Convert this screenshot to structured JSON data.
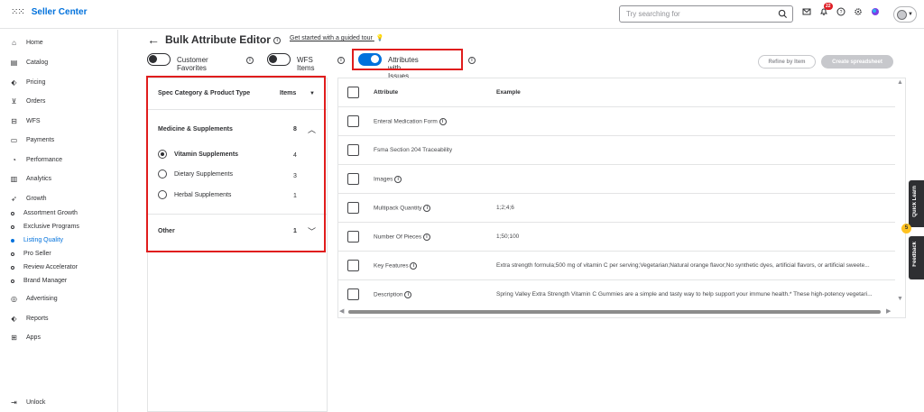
{
  "topbar": {
    "brand": "Seller Center",
    "search_placeholder": "Try searching for",
    "notification_count": "22"
  },
  "sidebar": {
    "items": [
      {
        "label": "Home",
        "icon": "home-icon"
      },
      {
        "label": "Catalog",
        "icon": "catalog-icon"
      },
      {
        "label": "Pricing",
        "icon": "tag-icon"
      },
      {
        "label": "Orders",
        "icon": "cart-icon"
      },
      {
        "label": "WFS",
        "icon": "warehouse-icon"
      },
      {
        "label": "Payments",
        "icon": "card-icon"
      },
      {
        "label": "Performance",
        "icon": "gauge-icon"
      },
      {
        "label": "Analytics",
        "icon": "bar-chart-icon"
      },
      {
        "label": "Growth",
        "icon": "rocket-icon"
      }
    ],
    "growth_sub": [
      {
        "label": "Assortment Growth",
        "active": false
      },
      {
        "label": "Exclusive Programs",
        "active": false
      },
      {
        "label": "Listing Quality",
        "active": true
      },
      {
        "label": "Pro Seller",
        "active": false
      },
      {
        "label": "Review Accelerator",
        "active": false
      },
      {
        "label": "Brand Manager",
        "active": false
      }
    ],
    "items2": [
      {
        "label": "Advertising",
        "icon": "target-icon"
      },
      {
        "label": "Reports",
        "icon": "report-icon"
      },
      {
        "label": "Apps",
        "icon": "apps-icon"
      }
    ],
    "unlock": "Unlock"
  },
  "header": {
    "title": "Bulk Attribute Editor",
    "guide_link": "Get started with a guided tour"
  },
  "toggles": [
    {
      "label": "Customer Favorites",
      "on": false
    },
    {
      "label": "WFS Items",
      "on": false
    },
    {
      "label": "Attributes with Issues",
      "on": true
    }
  ],
  "buttons": {
    "refine": "Refine by Item",
    "create": "Create spreadsheet"
  },
  "left_panel": {
    "header_label": "Spec Category & Product Type",
    "items_label": "Items",
    "group1": {
      "label": "Medicine & Supplements",
      "count": "8"
    },
    "options": [
      {
        "label": "Vitamin Supplements",
        "count": "4",
        "selected": true
      },
      {
        "label": "Dietary Supplements",
        "count": "3",
        "selected": false
      },
      {
        "label": "Herbal Supplements",
        "count": "1",
        "selected": false
      }
    ],
    "group2": {
      "label": "Other",
      "count": "1"
    }
  },
  "table": {
    "headers": {
      "attribute": "Attribute",
      "example": "Example"
    },
    "rows": [
      {
        "attribute": "Enteral Medication Form",
        "example": ""
      },
      {
        "attribute": "Fsma Section 204 Traceability",
        "example": ""
      },
      {
        "attribute": "Images",
        "example": ""
      },
      {
        "attribute": "Multipack Quantity",
        "example": "1;2;4;6"
      },
      {
        "attribute": "Number Of Pieces",
        "example": "1;50;100"
      },
      {
        "attribute": "Key Features",
        "example": "Extra strength formula;500 mg of vitamin C per serving;Vegetarian;Natural orange flavor;No synthetic dyes, artificial flavors, or artificial sweete..."
      },
      {
        "attribute": "Description",
        "example": "Spring Valley Extra Strength Vitamin C Gummies are a simple and tasty way to help support your immune health.* These high-potency vegetari..."
      }
    ]
  },
  "side_tabs": {
    "quick_learn": "Quick Learn",
    "feedback": "Feedback",
    "spark_count": "5"
  }
}
